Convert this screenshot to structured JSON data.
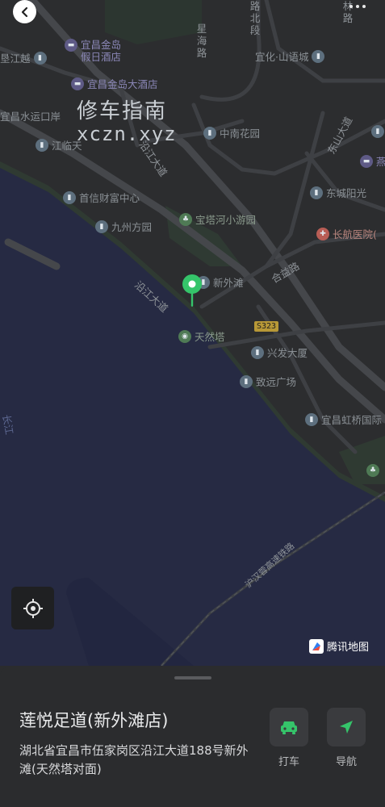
{
  "map": {
    "roads": {
      "xinghai": "星海路",
      "xiaoting_north": "路北段",
      "linlu": "林路",
      "yihua_shanyuncheng": "宜化·山语城",
      "wenjiang": "江临天",
      "yanjiang_road": "沿江大道",
      "hexie": "合益路",
      "yanjiang_vertical": "沿江大道",
      "dongshan": "东山大道",
      "river": "长江",
      "railway": "沪汉蓉高速铁路",
      "shield": "S323"
    },
    "pois": {
      "jindao_jiari": "宜昌金岛\n假日酒店",
      "jindao_dajiudian": "宜昌金岛大酒店",
      "shuiyun": "宜昌水运口岸",
      "zhongnan": "中南花园",
      "yan": "燕",
      "shouxin": "首信财富中心",
      "dongchengyangguang": "东城阳光",
      "jiuzhou": "九州方园",
      "baotahe": "宝塔河小游园",
      "changhang": "长航医院(",
      "xinwaitan": "新外滩",
      "tianranta": "天然塔",
      "xingfa": "兴发大厦",
      "zhiyuan": "致远广场",
      "hongqiao": "宜昌虹桥国际",
      "left_top": "宜昌水运口岸",
      "wenyue": "垦江越"
    },
    "watermark": {
      "line1": "修车指南",
      "line2": "xczn.xyz"
    },
    "brand": "腾讯地图"
  },
  "sheet": {
    "title": "莲悦足道(新外滩店)",
    "address": "湖北省宜昌市伍家岗区沿江大道188号新外滩(天然塔对面)",
    "actions": [
      {
        "label": "打车",
        "icon": "taxi-icon"
      },
      {
        "label": "导航",
        "icon": "navigation-icon"
      }
    ]
  },
  "colors": {
    "accent": "#35c46a",
    "land": "#2c2d2f",
    "water": "#262a43",
    "road": "#4a4c50"
  }
}
